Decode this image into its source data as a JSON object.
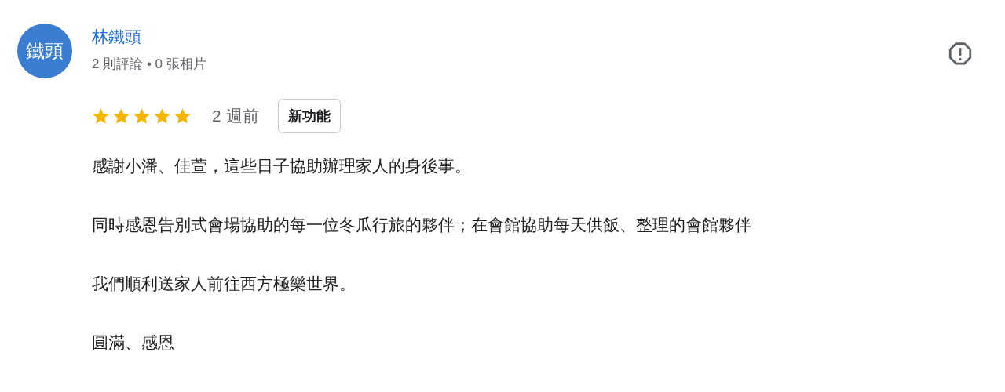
{
  "reviewer": {
    "avatar_text": "鐵頭",
    "name": "林鐵頭",
    "stats": "2 則評論 • 0 張相片"
  },
  "review": {
    "stars": 5,
    "time": "2 週前",
    "badge": "新功能",
    "paragraphs": [
      "感謝小潘、佳萱，這些日子協助辦理家人的身後事。",
      "同時感恩告別式會場協助的每一位冬瓜行旅的夥伴；在會館協助每天供飯、整理的會館夥伴",
      "我們順利送家人前往西方極樂世界。",
      "圓滿、感恩"
    ]
  }
}
